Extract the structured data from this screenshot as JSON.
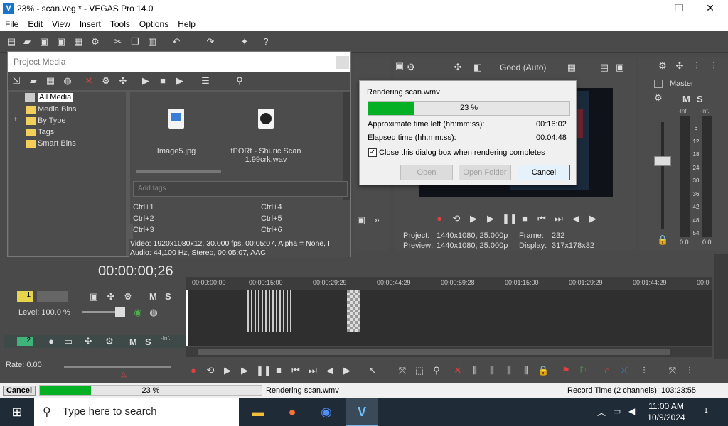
{
  "window": {
    "title": "23% - scan.veg * - VEGAS Pro 14.0",
    "logo": "V",
    "minimize": "—",
    "maximize": "❐",
    "close": "✕"
  },
  "menu": [
    "File",
    "Edit",
    "View",
    "Insert",
    "Tools",
    "Options",
    "Help"
  ],
  "project_media": {
    "title": "Project Media",
    "tree": [
      "All Media",
      "Media Bins",
      "By Type",
      "Tags",
      "Smart Bins"
    ],
    "expander": "+",
    "files": [
      {
        "name": "Image5.jpg"
      },
      {
        "name": "tPORt - Shuric Scan 1.99crk.wav"
      }
    ],
    "tags_placeholder": "Add tags",
    "shortcuts": [
      "Ctrl+1",
      "Ctrl+4",
      "Ctrl+2",
      "Ctrl+5",
      "Ctrl+3",
      "Ctrl+6"
    ],
    "info_video": "Video: 1920x1080x12, 30.000 fps, 00:05:07, Alpha = None, I",
    "info_audio": "Audio: 44,100 Hz, Stereo, 00:05:07, AAC"
  },
  "preview": {
    "quality": "Good (Auto)",
    "project_label": "Project:",
    "project_value": "1440x1080, 25.000p",
    "preview_label": "Preview:",
    "preview_value": "1440x1080, 25.000p",
    "frame_label": "Frame:",
    "frame_value": "232",
    "display_label": "Display:",
    "display_value": "317x178x32"
  },
  "master": {
    "title": "Master",
    "mute": "M",
    "solo": "S",
    "inf": "-Inf.",
    "scale": [
      "6",
      "12",
      "18",
      "24",
      "30",
      "36",
      "42",
      "48",
      "54"
    ],
    "readout_l": "0.0",
    "readout_r": "0.0"
  },
  "render_dialog": {
    "title": "Rendering scan.wmv",
    "progress": 0.23,
    "progress_text": "23 %",
    "time_left_label": "Approximate time left (hh:mm:ss):",
    "time_left_value": "00:16:02",
    "elapsed_label": "Elapsed time (hh:mm:ss):",
    "elapsed_value": "00:04:48",
    "checkbox_label": "Close this dialog box when rendering completes",
    "checkbox_mark": "✓",
    "open_label": "Open",
    "open_folder_label": "Open Folder",
    "cancel_label": "Cancel"
  },
  "timeline": {
    "timecode": "00:00:00;26",
    "ruler": [
      "00:00:00:00",
      "00:00:15:00",
      "00:00:29:29",
      "00:00:44:29",
      "00:00:59:28",
      "00:01:15:00",
      "00:01:29:29",
      "00:01:44:29",
      "00:0"
    ],
    "track1": {
      "num": "1",
      "level": "Level: 100.0 %",
      "mute": "M",
      "solo": "S"
    },
    "track2": {
      "num": "2",
      "mute": "M",
      "solo": "S",
      "inf": "-Inf."
    },
    "rate": "Rate: 0.00"
  },
  "status": {
    "cancel_label": "Cancel",
    "progress": 0.23,
    "progress_text": "23 %",
    "message": "Rendering scan.wmv",
    "record_time": "Record Time (2 channels): 103:23:55"
  },
  "taskbar": {
    "start": "⊞",
    "search_icon": "⚲",
    "search_placeholder": "Type here to search",
    "time": "11:00 AM",
    "date": "10/9/2024",
    "notif_count": "1",
    "tray_arrow": "︿",
    "apps": [
      {
        "name": "file-explorer-icon",
        "glyph": "▬",
        "color": "#f2c037"
      },
      {
        "name": "firefox-icon",
        "glyph": "●",
        "color": "#ff7139"
      },
      {
        "name": "chrome-icon",
        "glyph": "◉",
        "color": "#4e8ef7"
      },
      {
        "name": "vegas-icon",
        "glyph": "V",
        "color": "#6fc3ff"
      }
    ]
  }
}
